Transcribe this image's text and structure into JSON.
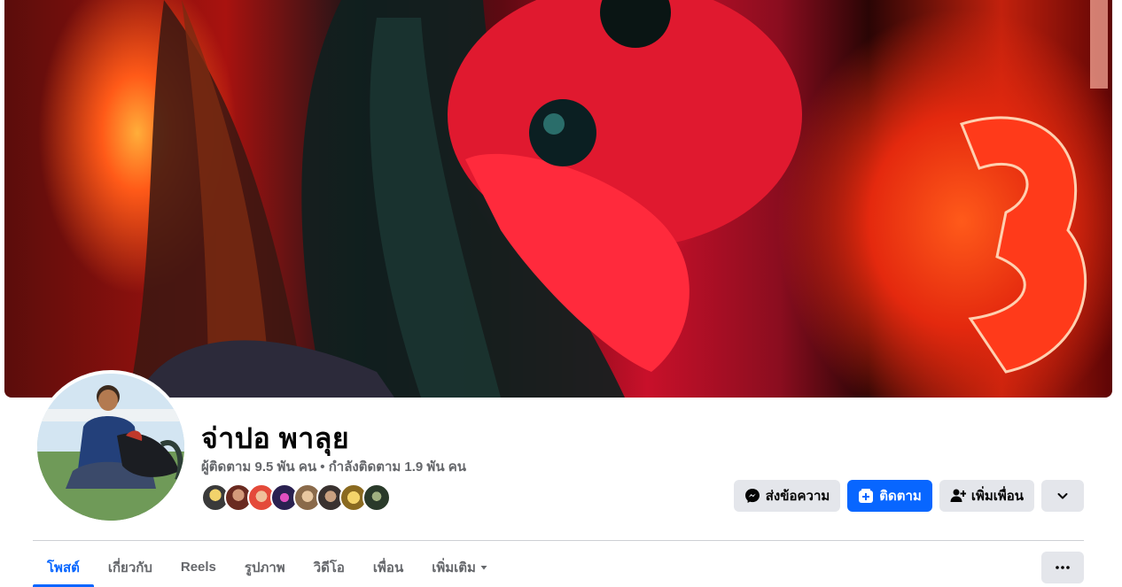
{
  "profile": {
    "name": "จ่าปอ พาลุย",
    "stats": "ผู้ติดตาม 9.5 พัน คน • กำลังติดตาม 1.9 พัน คน"
  },
  "friend_avatars": [
    {
      "color": "#c9a227"
    },
    {
      "color": "#a0563f"
    },
    {
      "color": "#d8483a"
    },
    {
      "color": "#5b4b8a"
    },
    {
      "color": "#c79a6b"
    },
    {
      "color": "#6d5a4c"
    },
    {
      "color": "#d4a52a"
    },
    {
      "color": "#3f5a3a"
    }
  ],
  "actions": {
    "message": "ส่งข้อความ",
    "follow": "ติดตาม",
    "add_friend": "เพิ่มเพื่อน"
  },
  "tabs": [
    {
      "label": "โพสต์",
      "active": true
    },
    {
      "label": "เกี่ยวกับ",
      "active": false
    },
    {
      "label": "Reels",
      "active": false
    },
    {
      "label": "รูปภาพ",
      "active": false
    },
    {
      "label": "วิดีโอ",
      "active": false
    },
    {
      "label": "เพื่อน",
      "active": false
    },
    {
      "label": "เพิ่มเติม",
      "active": false
    }
  ],
  "colors": {
    "accent": "#0866ff",
    "button_grey": "#e4e6eb",
    "secondary_text": "#65676b"
  },
  "icons": {
    "message": "messenger-icon",
    "follow": "follow-plus-icon",
    "add_friend": "add-friend-icon",
    "dropdown": "chevron-down-icon",
    "more": "more-dots-icon"
  }
}
